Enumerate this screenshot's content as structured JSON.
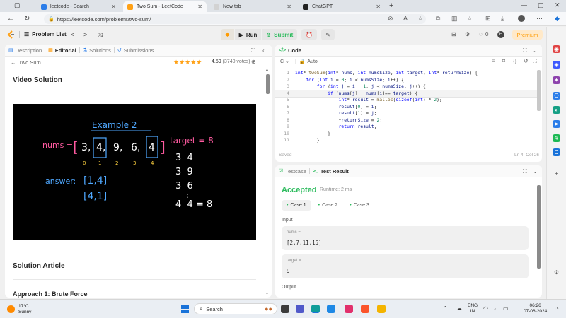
{
  "browser": {
    "tabs": [
      {
        "title": "leetcode - Search",
        "active": false
      },
      {
        "title": "Two Sum - LeetCode",
        "active": true
      },
      {
        "title": "New tab",
        "active": false
      },
      {
        "title": "ChatGPT",
        "active": false
      }
    ],
    "url": "https://leetcode.com/problems/two-sum/"
  },
  "header": {
    "problem_list": "Problem List",
    "run": "Run",
    "submit": "Submit",
    "streak": "0",
    "avatar_letter": "H",
    "premium": "Premium"
  },
  "left_panel": {
    "tabs": [
      "Description",
      "Editorial",
      "Solutions",
      "Submissions"
    ],
    "active_tab": "Editorial",
    "problem_title": "Two Sum",
    "rating": "4.59",
    "votes": "(3740 votes)",
    "video_heading": "Video Solution",
    "article_heading": "Solution Article",
    "approach_heading": "Approach 1: Brute Force",
    "video": {
      "title": "Example 2",
      "nums_label": "nums =",
      "nums": [
        "3,",
        "4,",
        "9,",
        "6,",
        "4"
      ],
      "indices": [
        "0",
        "1",
        "2",
        "3",
        "4"
      ],
      "target_label": "target = 8",
      "answer_label": "answer:",
      "answer1": "[1,4]",
      "answer2": "[4,1]",
      "pairs": [
        "3  4",
        "3  9",
        "3  6",
        ":",
        "4  4 = 8"
      ]
    }
  },
  "code_panel": {
    "title": "Code",
    "language": "Auto",
    "saved": "Saved",
    "cursor": "Ln 4, Col 26",
    "highlight_line": 4
  },
  "test_panel": {
    "tabs": [
      "Testcase",
      "Test Result"
    ],
    "active_tab": "Test Result",
    "status": "Accepted",
    "runtime": "Runtime: 2 ms",
    "cases": [
      "Case 1",
      "Case 2",
      "Case 3"
    ],
    "input_label": "Input",
    "params": [
      {
        "name": "nums =",
        "value": "[2,7,11,15]"
      },
      {
        "name": "target =",
        "value": "9"
      }
    ],
    "output_label": "Output"
  },
  "taskbar": {
    "temperature": "17°C",
    "weather": "Sunny",
    "search": "Search",
    "lang1": "ENG",
    "lang2": "IN",
    "time": "06:26",
    "date": "07-06-2024"
  },
  "colors": {
    "accent_orange": "#ffa116",
    "accepted_green": "#2cbb5d",
    "brand_leetcode": "#ffa116"
  }
}
